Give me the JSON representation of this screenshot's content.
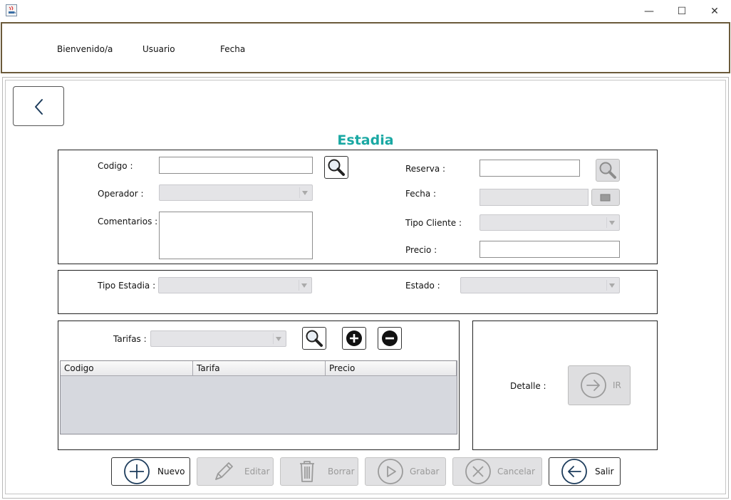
{
  "window": {
    "minimize_icon": "—",
    "maximize_icon": "☐",
    "close_icon": "✕"
  },
  "header": {
    "welcome": "Bienvenido/a",
    "user": "Usuario",
    "date": "Fecha"
  },
  "page": {
    "title": "Estadia"
  },
  "form": {
    "codigo_label": "Codigo :",
    "codigo_value": "",
    "operador_label": "Operador :",
    "comentarios_label": "Comentarios :",
    "reserva_label": "Reserva :",
    "reserva_value": "",
    "fecha_label": "Fecha :",
    "tipo_cliente_label": "Tipo Cliente :",
    "precio_label": "Precio :",
    "precio_value": "",
    "tipo_estadia_label": "Tipo Estadia :",
    "estado_label": "Estado :",
    "tarifas_label": "Tarifas :"
  },
  "table": {
    "columns": [
      "Codigo",
      "Tarifa",
      "Precio"
    ],
    "rows": []
  },
  "detalle": {
    "label": "Detalle :",
    "ir_label": "IR"
  },
  "buttons": {
    "nuevo": "Nuevo",
    "editar": "Editar",
    "borrar": "Borrar",
    "grabar": "Grabar",
    "cancelar": "Cancelar",
    "salir": "Salir"
  },
  "colors": {
    "title": "#1aa8a3",
    "primary_icon": "#1d3c5c",
    "disabled_icon": "#9b9b9b",
    "header_border": "#6b5a3a"
  }
}
